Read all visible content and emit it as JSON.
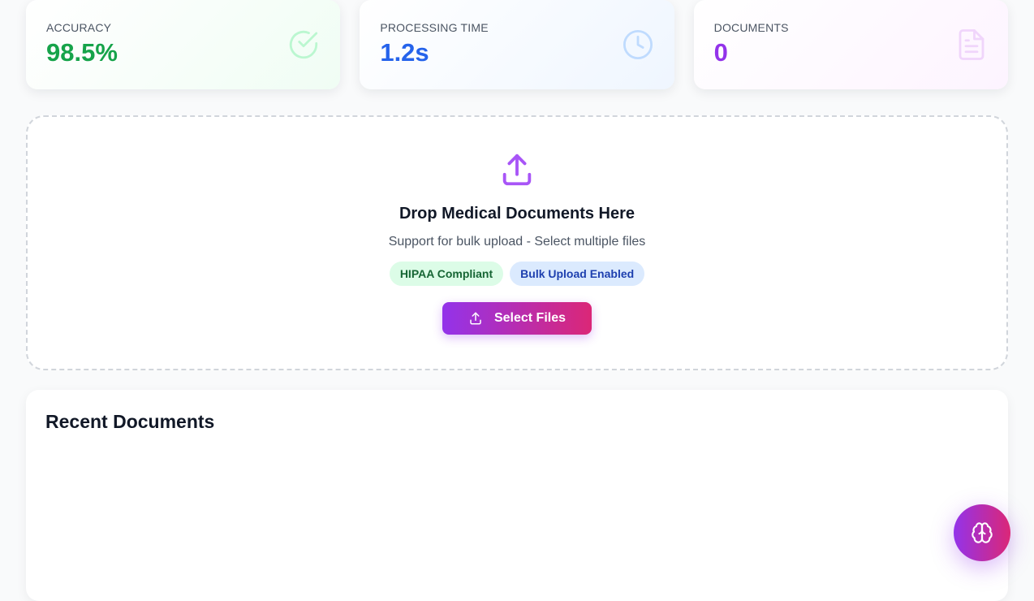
{
  "stats": [
    {
      "label": "ACCURACY",
      "value": "98.5%",
      "icon": "check-circle-icon",
      "color": "#16a34a"
    },
    {
      "label": "PROCESSING TIME",
      "value": "1.2s",
      "icon": "clock-icon",
      "color": "#2563eb"
    },
    {
      "label": "DOCUMENTS",
      "value": "0",
      "icon": "document-icon",
      "color": "#9333ea"
    }
  ],
  "upload": {
    "icon": "upload-icon",
    "title": "Drop Medical Documents Here",
    "subtitle": "Support for bulk upload - Select multiple files",
    "badges": [
      "HIPAA Compliant",
      "Bulk Upload Enabled"
    ],
    "button_label": "Select Files"
  },
  "recent": {
    "title": "Recent Documents"
  },
  "fab": {
    "icon": "brain-icon"
  },
  "colors": {
    "accent_start": "#9333ea",
    "accent_end": "#db2777"
  }
}
